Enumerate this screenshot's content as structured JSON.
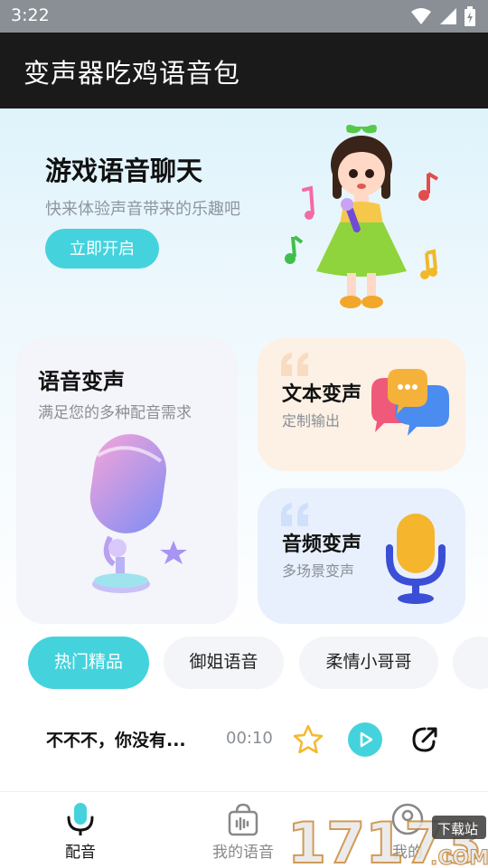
{
  "status_bar": {
    "time": "3:22"
  },
  "app_bar": {
    "title": "变声器吃鸡语音包"
  },
  "hero": {
    "title": "游戏语音聊天",
    "subtitle": "快来体验声音带来的乐趣吧",
    "button": "立即开启"
  },
  "cards": {
    "voice": {
      "title": "语音变声",
      "subtitle": "满足您的多种配音需求"
    },
    "text": {
      "title": "文本变声",
      "subtitle": "定制输出"
    },
    "audio": {
      "title": "音频变声",
      "subtitle": "多场景变声"
    }
  },
  "chips": [
    "热门精品",
    "御姐语音",
    "柔情小哥哥"
  ],
  "track": {
    "title": "不不不，你没有...",
    "duration": "00:10"
  },
  "nav": {
    "items": [
      "配音",
      "我的语音",
      "我的"
    ]
  },
  "watermark": {
    "text": "17173",
    "badge": "下载站",
    "suffix": ".COM"
  },
  "colors": {
    "accent": "#44d3dd",
    "star": "#f5b82e",
    "appbar": "#1a1a1a"
  }
}
